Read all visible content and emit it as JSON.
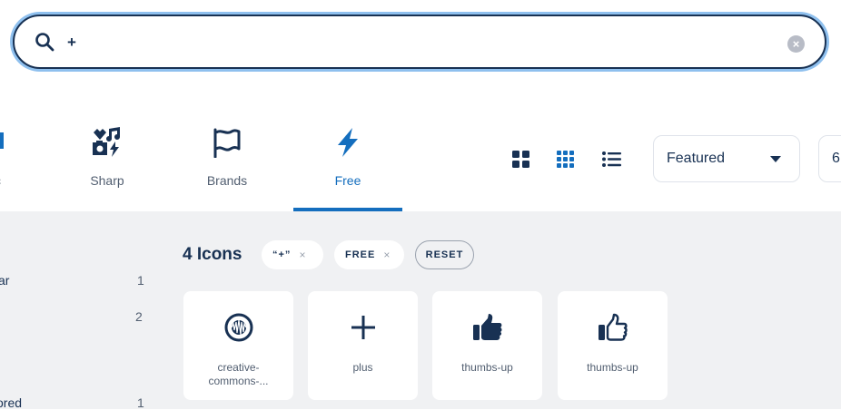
{
  "search": {
    "value": "+",
    "clear_label": "×"
  },
  "style_tabs": {
    "partial_label": "c",
    "sharp": "Sharp",
    "brands": "Brands",
    "free": "Free"
  },
  "view_options": [
    "view-large",
    "view-medium",
    "view-list"
  ],
  "sort": {
    "selected": "Featured"
  },
  "version": {
    "value": "6."
  },
  "sidebar": {
    "facets": [
      {
        "label": "ar",
        "count": "1"
      },
      {
        "label": "",
        "count": "2"
      },
      {
        "label": "ored",
        "count": "1"
      }
    ]
  },
  "results": {
    "count_label": "4 Icons",
    "chips": [
      {
        "label": "“+”",
        "remove": "×"
      },
      {
        "label": "FREE",
        "remove": "×"
      }
    ],
    "reset_label": "RESET",
    "icons": [
      {
        "name_line1": "creative-",
        "name_line2": "commons-...",
        "icon": "creative-commons-icon"
      },
      {
        "name_line1": "plus",
        "name_line2": "",
        "icon": "plus-icon"
      },
      {
        "name_line1": "thumbs-up",
        "name_line2": "",
        "icon": "thumbs-up-solid-icon"
      },
      {
        "name_line1": "thumbs-up",
        "name_line2": "",
        "icon": "thumbs-up-regular-icon"
      }
    ]
  },
  "colors": {
    "primary": "#183153",
    "accent": "#146ebe",
    "focus_ring": "#8fc0ee",
    "background_gray": "#f0f1f3"
  }
}
